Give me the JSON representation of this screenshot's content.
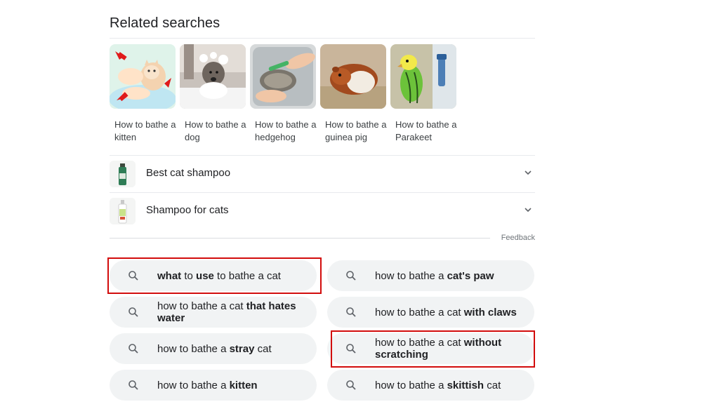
{
  "related": {
    "title": "Related searches",
    "tiles": [
      {
        "label": "How to bathe a kitten"
      },
      {
        "label": "How to bathe a dog"
      },
      {
        "label": "How to bathe a hedgehog"
      },
      {
        "label": "How to bathe a guinea pig"
      },
      {
        "label": "How to bathe a Parakeet"
      }
    ]
  },
  "accordion": [
    {
      "label": "Best cat shampoo",
      "icon": "chevron-down-icon"
    },
    {
      "label": "Shampoo for cats",
      "icon": "chevron-down-icon"
    }
  ],
  "feedback": "Feedback",
  "chips": [
    {
      "parts": [
        {
          "t": "what",
          "b": true
        },
        {
          "t": " to ",
          "b": false
        },
        {
          "t": "use",
          "b": true
        },
        {
          "t": " to bathe a cat",
          "b": false
        }
      ]
    },
    {
      "parts": [
        {
          "t": "how to bathe a ",
          "b": false
        },
        {
          "t": "cat's paw",
          "b": true
        }
      ]
    },
    {
      "parts": [
        {
          "t": "how to bathe a cat ",
          "b": false
        },
        {
          "t": "that hates water",
          "b": true
        }
      ]
    },
    {
      "parts": [
        {
          "t": "how to bathe a cat ",
          "b": false
        },
        {
          "t": "with claws",
          "b": true
        }
      ]
    },
    {
      "parts": [
        {
          "t": "how to bathe a ",
          "b": false
        },
        {
          "t": "stray",
          "b": true
        },
        {
          "t": " cat",
          "b": false
        }
      ]
    },
    {
      "parts": [
        {
          "t": "how to bathe a cat ",
          "b": false
        },
        {
          "t": "without scratching",
          "b": true
        }
      ]
    },
    {
      "parts": [
        {
          "t": "how to bathe a ",
          "b": false
        },
        {
          "t": "kitten",
          "b": true
        }
      ]
    },
    {
      "parts": [
        {
          "t": "how to bathe a ",
          "b": false
        },
        {
          "t": "skittish",
          "b": true
        },
        {
          "t": " cat",
          "b": false
        }
      ]
    }
  ],
  "colors": {
    "chip_bg": "#f1f3f4",
    "highlight": "#d20c0c",
    "divider": "#e8eaed"
  }
}
